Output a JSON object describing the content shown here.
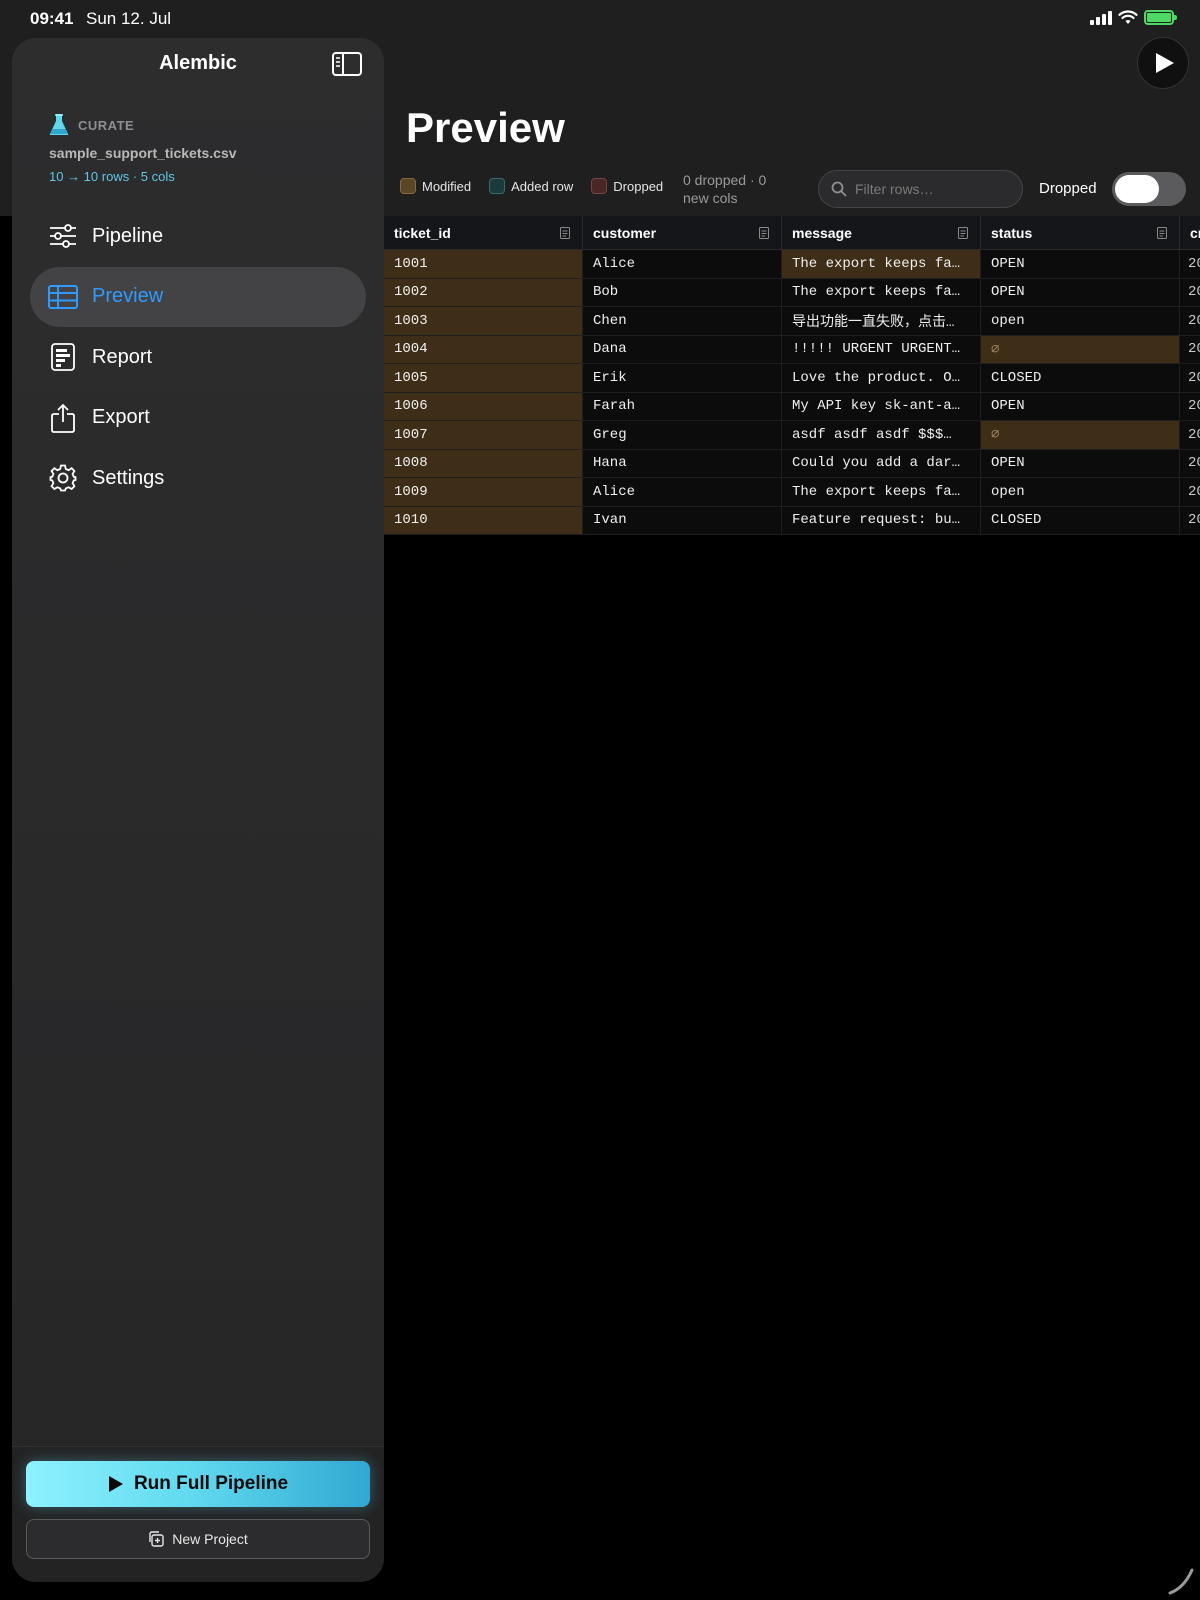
{
  "status_bar": {
    "time": "09:41",
    "date": "Sun 12. Jul"
  },
  "sidebar": {
    "title": "Alembic",
    "project": {
      "kicker": "CURATE",
      "file_name": "sample_support_tickets.csv",
      "meta": "10 → 10 rows · 5 cols"
    },
    "nav": [
      {
        "label": "Pipeline",
        "icon": "sliders-icon",
        "active": false
      },
      {
        "label": "Preview",
        "icon": "table-icon",
        "active": true
      },
      {
        "label": "Report",
        "icon": "report-icon",
        "active": false
      },
      {
        "label": "Export",
        "icon": "share-icon",
        "active": false
      },
      {
        "label": "Settings",
        "icon": "gear-icon",
        "active": false
      }
    ],
    "run_button": "Run Full Pipeline",
    "new_project_button": "New Project"
  },
  "main": {
    "title": "Preview",
    "legend": {
      "modified": "Modified",
      "added": "Added row",
      "dropped": "Dropped"
    },
    "drop_summary": "0 dropped · 0 new cols",
    "filter": {
      "placeholder": "Filter rows…",
      "value": ""
    },
    "toggle": {
      "label": "Dropped",
      "on": false
    },
    "colors": {
      "modified": "#3f2e17",
      "accent": "#2f9bff",
      "run_gradient_start": "#8ef2ff",
      "run_gradient_end": "#30a8d2"
    }
  },
  "table": {
    "columns": [
      "ticket_id",
      "customer",
      "message",
      "status",
      "cr"
    ],
    "rows": [
      {
        "ticket_id": "1001",
        "customer": "Alice",
        "message": "The export keeps fa…",
        "status": "OPEN",
        "cr": "20"
      },
      {
        "ticket_id": "1002",
        "customer": "Bob",
        "message": "The export keeps fa…",
        "status": "OPEN",
        "cr": "20"
      },
      {
        "ticket_id": "1003",
        "customer": "Chen",
        "message": "导出功能一直失败，点击…",
        "status": "open",
        "cr": "20"
      },
      {
        "ticket_id": "1004",
        "customer": "Dana",
        "message": "!!!!! URGENT URGENT…",
        "status": "∅",
        "cr": "20"
      },
      {
        "ticket_id": "1005",
        "customer": "Erik",
        "message": "Love the product. O…",
        "status": "CLOSED",
        "cr": "20"
      },
      {
        "ticket_id": "1006",
        "customer": "Farah",
        "message": "My API key sk-ant-a…",
        "status": "OPEN",
        "cr": "20"
      },
      {
        "ticket_id": "1007",
        "customer": "Greg",
        "message": "asdf asdf asdf $$$…",
        "status": "∅",
        "cr": "20"
      },
      {
        "ticket_id": "1008",
        "customer": "Hana",
        "message": "Could you add a dar…",
        "status": "OPEN",
        "cr": "20"
      },
      {
        "ticket_id": "1009",
        "customer": "Alice",
        "message": "The export keeps fa…",
        "status": "open",
        "cr": "20"
      },
      {
        "ticket_id": "1010",
        "customer": "Ivan",
        "message": "Feature request: bu…",
        "status": "CLOSED",
        "cr": "20"
      }
    ]
  }
}
